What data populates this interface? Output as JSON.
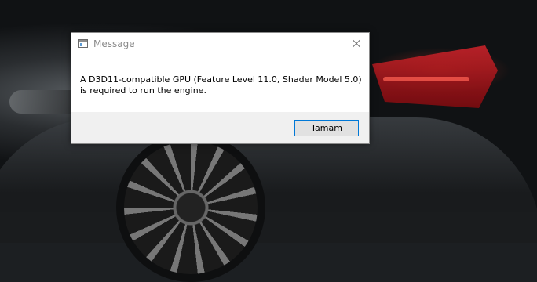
{
  "dialog": {
    "title": "Message",
    "message": "A D3D11-compatible GPU (Feature Level 11.0, Shader Model 5.0) is required to run the engine.",
    "ok_label": "Tamam",
    "accent_color": "#0078d7"
  },
  "icons": {
    "app": "window-app-icon",
    "close": "close-icon"
  }
}
